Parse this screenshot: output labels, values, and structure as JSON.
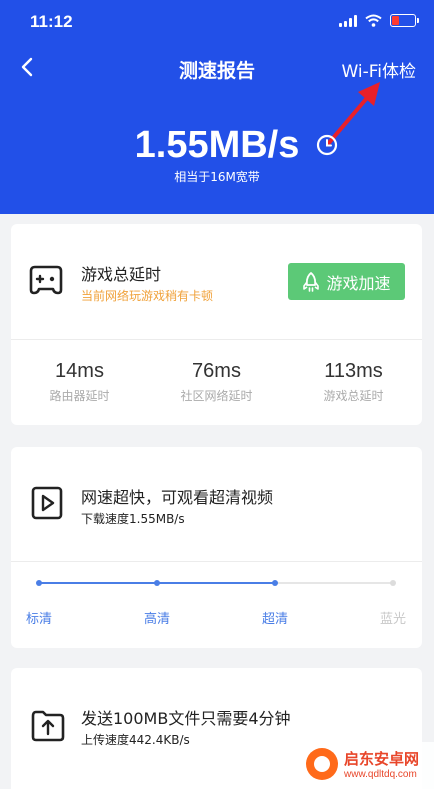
{
  "status_bar": {
    "time": "11:12"
  },
  "navbar": {
    "title": "测速报告",
    "right_action": "Wi-Fi体检"
  },
  "hero": {
    "speed": "1.55MB/s",
    "equivalent": "相当于16M宽带"
  },
  "game_card": {
    "title": "游戏总延时",
    "subtitle": "当前网络玩游戏稍有卡顿",
    "accelerate_label": "游戏加速",
    "latencies": [
      {
        "value": "14ms",
        "label": "路由器延时"
      },
      {
        "value": "76ms",
        "label": "社区网络延时"
      },
      {
        "value": "113ms",
        "label": "游戏总延时"
      }
    ]
  },
  "video_card": {
    "title": "网速超快，可观看超清视频",
    "subtitle": "下载速度1.55MB/s",
    "qualities": [
      "标清",
      "高清",
      "超清",
      "蓝光"
    ],
    "achieved_index": 2
  },
  "upload_card": {
    "title": "发送100MB文件只需要4分钟",
    "subtitle": "上传速度442.4KB/s"
  },
  "watermark": {
    "name": "启东安卓网",
    "url": "www.qdltdq.com"
  },
  "colors": {
    "brand_blue": "#2250e8",
    "accent_green": "#5cc977",
    "warning_orange": "#f0a23b",
    "active_blue": "#4a7ee6",
    "annotation_red": "#e8202a"
  },
  "icons": {
    "back": "chevron-left-icon",
    "history": "clock-icon",
    "game": "gamepad-icon",
    "rocket": "rocket-icon",
    "video": "play-icon",
    "upload": "upload-folder-icon"
  }
}
